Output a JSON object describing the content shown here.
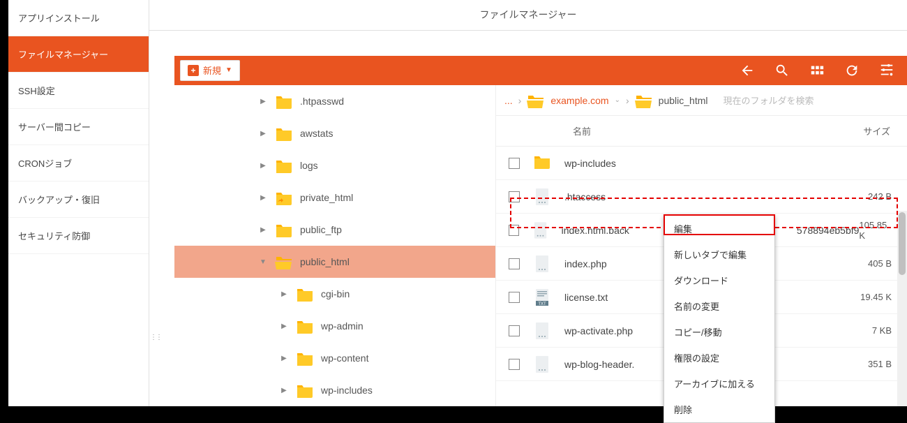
{
  "header": {
    "title": "ファイルマネージャー"
  },
  "sidebar": {
    "items": [
      {
        "label": "アプリインストール"
      },
      {
        "label": "ファイルマネージャー",
        "active": true
      },
      {
        "label": "SSH設定"
      },
      {
        "label": "サーバー間コピー"
      },
      {
        "label": "CRONジョブ"
      },
      {
        "label": "バックアップ・復旧"
      },
      {
        "label": "セキュリティ防御"
      }
    ]
  },
  "toolbar": {
    "new_label": "新規",
    "icons": [
      "back",
      "search",
      "grid",
      "refresh",
      "settings"
    ]
  },
  "breadcrumb": {
    "ellipsis": "...",
    "parent": "example.com",
    "current": "public_html",
    "search_placeholder": "現在のフォルダを検索"
  },
  "tree": [
    {
      "name": ".htpasswd",
      "indent": 1,
      "expander": "▶"
    },
    {
      "name": "awstats",
      "indent": 1,
      "expander": "▶"
    },
    {
      "name": "logs",
      "indent": 1,
      "expander": "▶"
    },
    {
      "name": "private_html",
      "indent": 1,
      "expander": "▶",
      "variant": "link"
    },
    {
      "name": "public_ftp",
      "indent": 1,
      "expander": "▶"
    },
    {
      "name": "public_html",
      "indent": 1,
      "expander": "▼",
      "selected": true,
      "variant": "open"
    },
    {
      "name": "cgi-bin",
      "indent": 2,
      "expander": "▶"
    },
    {
      "name": "wp-admin",
      "indent": 2,
      "expander": "▶"
    },
    {
      "name": "wp-content",
      "indent": 2,
      "expander": "▶"
    },
    {
      "name": "wp-includes",
      "indent": 2,
      "expander": "▶"
    }
  ],
  "list": {
    "columns": {
      "name": "名前",
      "size": "サイズ"
    },
    "rows": [
      {
        "name": "wp-includes",
        "type": "folder",
        "size": ""
      },
      {
        "name": ".htaccess",
        "type": "file",
        "size": "242 B",
        "highlighted": true
      },
      {
        "name": "index.html.back",
        "name_suffix": "578894eb5bf9",
        "type": "file",
        "size": "105.85 K"
      },
      {
        "name": "index.php",
        "type": "file",
        "size": "405 B"
      },
      {
        "name": "license.txt",
        "type": "txt",
        "size": "19.45 K"
      },
      {
        "name": "wp-activate.php",
        "type": "file",
        "size": "7 KB"
      },
      {
        "name": "wp-blog-header.",
        "type": "file",
        "size": "351 B"
      }
    ]
  },
  "context_menu": {
    "items": [
      {
        "label": "編集",
        "highlighted": true
      },
      {
        "label": "新しいタブで編集"
      },
      {
        "label": "ダウンロード"
      },
      {
        "label": "名前の変更"
      },
      {
        "label": "コピー/移動"
      },
      {
        "label": "権限の設定"
      },
      {
        "label": "アーカイブに加える"
      },
      {
        "label": "削除"
      }
    ]
  }
}
